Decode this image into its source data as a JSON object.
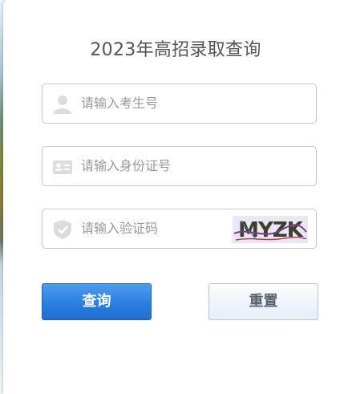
{
  "form": {
    "title": "2023年高招录取查询",
    "exam_number": {
      "placeholder": "请输入考生号",
      "icon": "user-icon"
    },
    "id_number": {
      "placeholder": "请输入身份证号",
      "icon": "id-card-icon"
    },
    "captcha": {
      "placeholder": "请输入验证码",
      "icon": "shield-icon",
      "image_text": "MYZK"
    }
  },
  "buttons": {
    "query_label": "查询",
    "reset_label": "重置"
  },
  "colors": {
    "primary": "#2a7fe0",
    "icon_gray": "#dcdcdc",
    "placeholder": "#9a9a9a",
    "title": "#555555"
  }
}
